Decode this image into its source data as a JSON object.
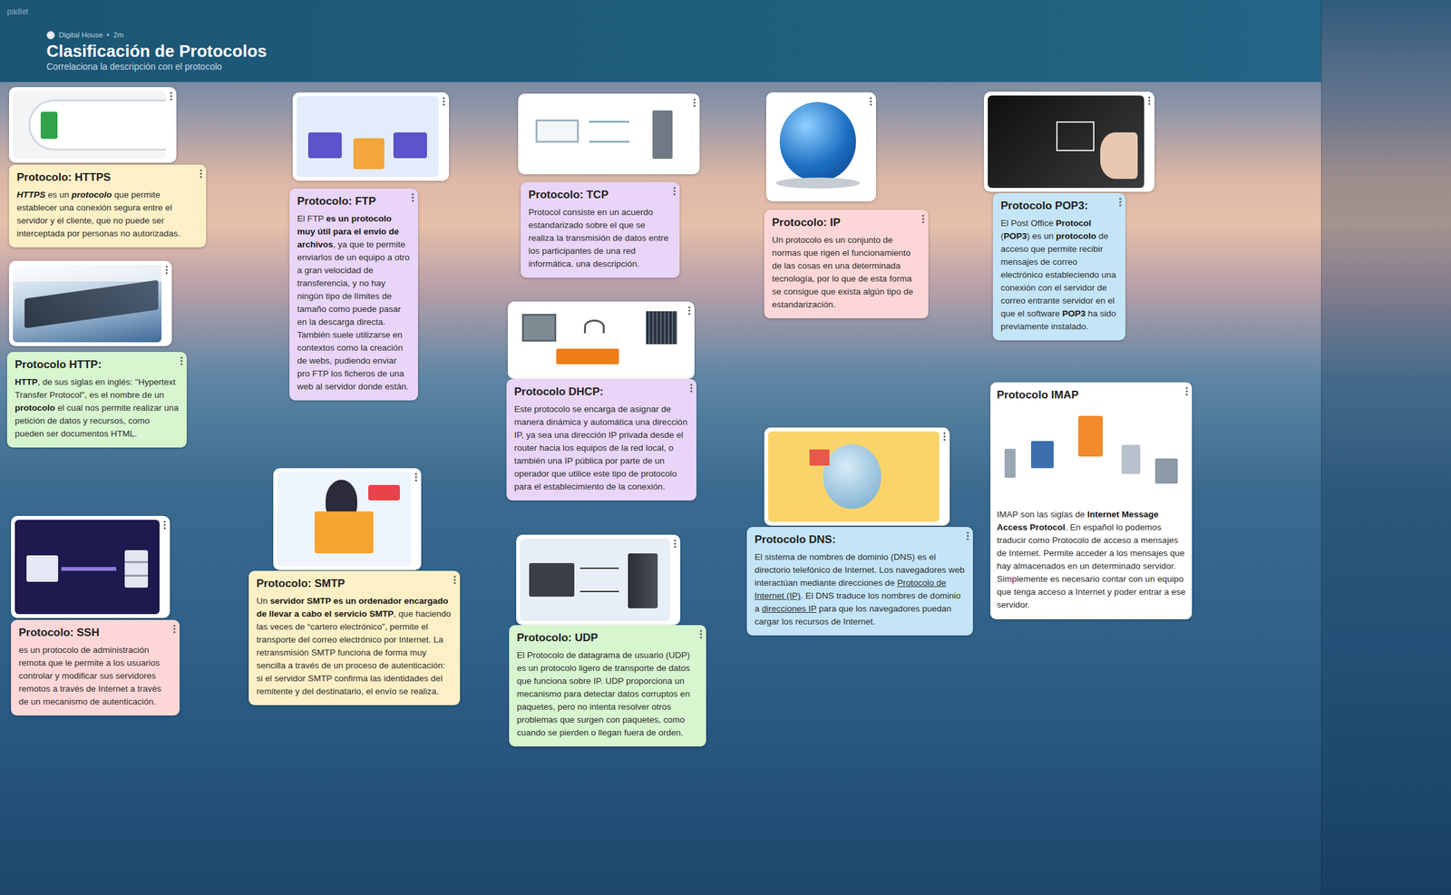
{
  "app": {
    "brand": "padlet"
  },
  "board": {
    "author": "Digital House",
    "age": "2m",
    "title": "Clasificación de Protocolos",
    "subtitle": "Correlaciona la descripción con el protocolo"
  },
  "posts": [
    {
      "kind": "image"
    },
    {
      "kind": "note",
      "color": "#fdf0c6",
      "title": "Protocolo: HTTPS",
      "body": [
        {
          "text": "HTTPS",
          "emphasis": "bold-italic"
        },
        {
          "text": " es un ",
          "emphasis": "none"
        },
        {
          "text": "protocolo",
          "emphasis": "bold-italic"
        },
        {
          "text": " que permite establecer una conexión segura entre el servidor y el cliente, que no puede ser interceptada por personas no autorizadas.",
          "emphasis": "none"
        }
      ]
    },
    {
      "kind": "image"
    },
    {
      "kind": "note",
      "color": "#d7f5cf",
      "title": "Protocolo HTTP:",
      "body": [
        {
          "text": "HTTP",
          "emphasis": "bold"
        },
        {
          "text": ", de sus siglas en inglés: \"Hypertext Transfer Protocol\", es el nombre de un ",
          "emphasis": "none"
        },
        {
          "text": "protocolo",
          "emphasis": "bold"
        },
        {
          "text": " el cual nos permite realizar una petición de datos y recursos, como pueden ser documentos HTML.",
          "emphasis": "none"
        }
      ]
    },
    {
      "kind": "image"
    },
    {
      "kind": "note",
      "color": "#fdd7d7",
      "title": "Protocolo: SSH",
      "body": [
        {
          "text": "es un protocolo de administración remota que le permite a los usuarios controlar y modificar sus servidores remotos a través de Internet a través de un mecanismo de autenticación.",
          "emphasis": "none"
        }
      ]
    },
    {
      "kind": "image"
    },
    {
      "kind": "note",
      "color": "#e8d5f7",
      "title": "Protocolo: FTP",
      "body": [
        {
          "text": "El FTP ",
          "emphasis": "none"
        },
        {
          "text": "es un protocolo muy útil para el envío de archivos",
          "emphasis": "bold"
        },
        {
          "text": ", ya que te permite enviarlos de un equipo a otro a gran velocidad de transferencia, y no hay ningún tipo de límites de tamaño como puede pasar en la descarga directa. También suele utilizarse en contextos como la creación de webs, pudiendo enviar pro FTP los ficheros de una web al servidor donde están.",
          "emphasis": "none"
        }
      ]
    },
    {
      "kind": "image"
    },
    {
      "kind": "note",
      "color": "#fdf0c6",
      "title": "Protocolo: SMTP",
      "body": [
        {
          "text": "Un ",
          "emphasis": "none"
        },
        {
          "text": "servidor SMTP es un ordenador encargado de llevar a cabo el servicio SMTP",
          "emphasis": "bold"
        },
        {
          "text": ", que haciendo las veces de “cartero electrónico”, permite el transporte del correo electrónico por Internet. La retransmisión SMTP funciona de forma muy sencilla a través de un proceso de autenticación: si el servidor SMTP confirma las identidades del remitente y del destinatario, el envío se realiza.",
          "emphasis": "none"
        }
      ]
    },
    {
      "kind": "image"
    },
    {
      "kind": "note",
      "color": "#e8d5f7",
      "title": "Protocolo: TCP",
      "body": [
        {
          "text": "Protocol consiste en un acuerdo estandarizado sobre el que se realiza la transmisión de datos entre los participantes de una red informática. una descripción.",
          "emphasis": "none"
        }
      ]
    },
    {
      "kind": "image"
    },
    {
      "kind": "note",
      "color": "#e8d5f7",
      "title": "Protocolo DHCP:",
      "body": [
        {
          "text": "Este protocolo se encarga de asignar de manera dinámica y automática una dirección IP, ya sea una dirección IP privada desde el router hacia los equipos de la red local, o también una IP pública por parte de un operador que utilice este tipo de protocolo para el establecimiento de la conexión.",
          "emphasis": "none"
        }
      ]
    },
    {
      "kind": "image"
    },
    {
      "kind": "note",
      "color": "#d7f5cf",
      "title": "Protocolo: UDP",
      "body": [
        {
          "text": "El Protocolo de datagrama de usuario (UDP) es un protocolo ligero de transporte de datos que funciona sobre IP. UDP proporciona un mecanismo para detectar datos corruptos en paquetes, pero no intenta resolver otros problemas que surgen con paquetes, como cuando se pierden o llegan fuera de orden.",
          "emphasis": "none"
        }
      ]
    },
    {
      "kind": "image"
    },
    {
      "kind": "note",
      "color": "#fdd7d7",
      "title": "Protocolo: IP",
      "body": [
        {
          "text": "Un protocolo es un conjunto de normas que rigen el funcionamiento de las cosas en una determinada tecnología, por lo que de esta forma se consigue que exista algún tipo de estandarización.",
          "emphasis": "none"
        }
      ]
    },
    {
      "kind": "image"
    },
    {
      "kind": "note",
      "color": "#c4e5f8",
      "title": "Protocolo DNS:",
      "body": [
        {
          "text": "El sistema de nombres de dominio (DNS) es el directorio telefónico de Internet. Los navegadores web interactúan mediante direcciones de ",
          "emphasis": "none"
        },
        {
          "text": "Protocolo de Internet (IP)",
          "emphasis": "underline"
        },
        {
          "text": ". El DNS traduce los nombres de dominio a ",
          "emphasis": "none"
        },
        {
          "text": "direcciones IP",
          "emphasis": "underline"
        },
        {
          "text": " para que los navegadores puedan cargar los recursos de Internet.",
          "emphasis": "none"
        }
      ]
    },
    {
      "kind": "image"
    },
    {
      "kind": "note",
      "color": "#c4e5f8",
      "title": "Protocolo POP3:",
      "body": [
        {
          "text": "El Post Office ",
          "emphasis": "none"
        },
        {
          "text": "Protocol",
          "emphasis": "bold"
        },
        {
          "text": " (",
          "emphasis": "none"
        },
        {
          "text": "POP3",
          "emphasis": "bold"
        },
        {
          "text": ") es un ",
          "emphasis": "none"
        },
        {
          "text": "protocolo",
          "emphasis": "bold"
        },
        {
          "text": " de acceso que permite recibir mensajes de correo electrónico estableciendo una conexión con el servidor de correo entrante servidor en el que el software ",
          "emphasis": "none"
        },
        {
          "text": "POP3",
          "emphasis": "bold"
        },
        {
          "text": " ha sido previamente instalado.",
          "emphasis": "none"
        }
      ]
    },
    {
      "kind": "card",
      "color": "#ffffff",
      "title": "Protocolo IMAP",
      "body": [
        {
          "text": "IMAP son las siglas de ",
          "emphasis": "none"
        },
        {
          "text": "Internet Message Access Protocol",
          "emphasis": "bold"
        },
        {
          "text": ". En español lo podemos traducir como Protocolo de acceso a mensajes de Internet. Permite acceder a los mensajes que hay almacenados en un determinado servidor. Simplemente es necesario contar con un equipo que tenga acceso a Internet y poder entrar a ese servidor.",
          "emphasis": "none"
        }
      ]
    }
  ]
}
